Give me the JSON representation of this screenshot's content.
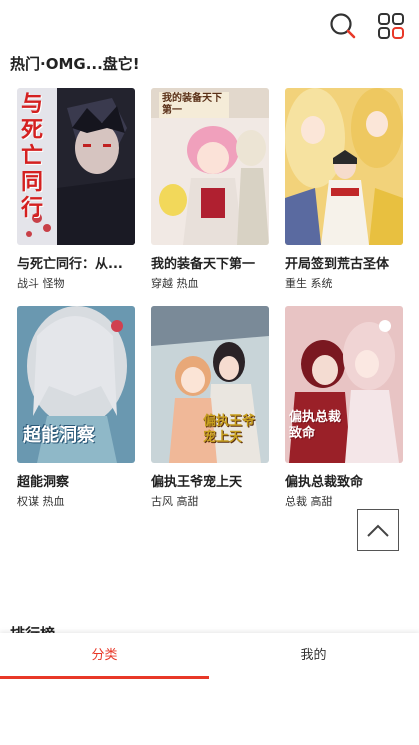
{
  "header": {
    "search_icon": "search-icon",
    "menu_icon": "grid-menu-icon",
    "accent": "#e83828"
  },
  "section": {
    "title": "热门·OMG...盘它!"
  },
  "comics": [
    {
      "title": "与死亡同行：从...",
      "tags": "战斗 怪物",
      "cover_text": "与死亡同行",
      "cover_colors": [
        "#2a2a38",
        "#d8d8e0"
      ]
    },
    {
      "title": "我的装备天下第一",
      "tags": "穿越 热血",
      "cover_text": "我的装备天下第一",
      "cover_colors": [
        "#f3e8e4",
        "#e8a0b4"
      ]
    },
    {
      "title": "开局签到荒古圣体",
      "tags": "重生 系统",
      "cover_text": "",
      "cover_colors": [
        "#e9c860",
        "#f4e2a0"
      ]
    },
    {
      "title": "超能洞察",
      "tags": "权谋 热血",
      "cover_text": "超能洞察",
      "cover_colors": [
        "#5e8fa8",
        "#c8d8e0"
      ]
    },
    {
      "title": "偏执王爷宠上天",
      "tags": "古风 高甜",
      "cover_text": "偏执王爷宠上天",
      "cover_colors": [
        "#8fa8b8",
        "#e0d0b8"
      ]
    },
    {
      "title": "偏执总裁致命",
      "tags": "总裁 高甜",
      "cover_text": "偏执总裁致命",
      "cover_colors": [
        "#d8a8a8",
        "#9a2028"
      ]
    }
  ],
  "back_to_top": {
    "icon": "chevron-up-icon"
  },
  "rank": {
    "title": "排行榜"
  },
  "tabs": [
    {
      "label": "分类",
      "active": true
    },
    {
      "label": "我的",
      "active": false
    }
  ]
}
